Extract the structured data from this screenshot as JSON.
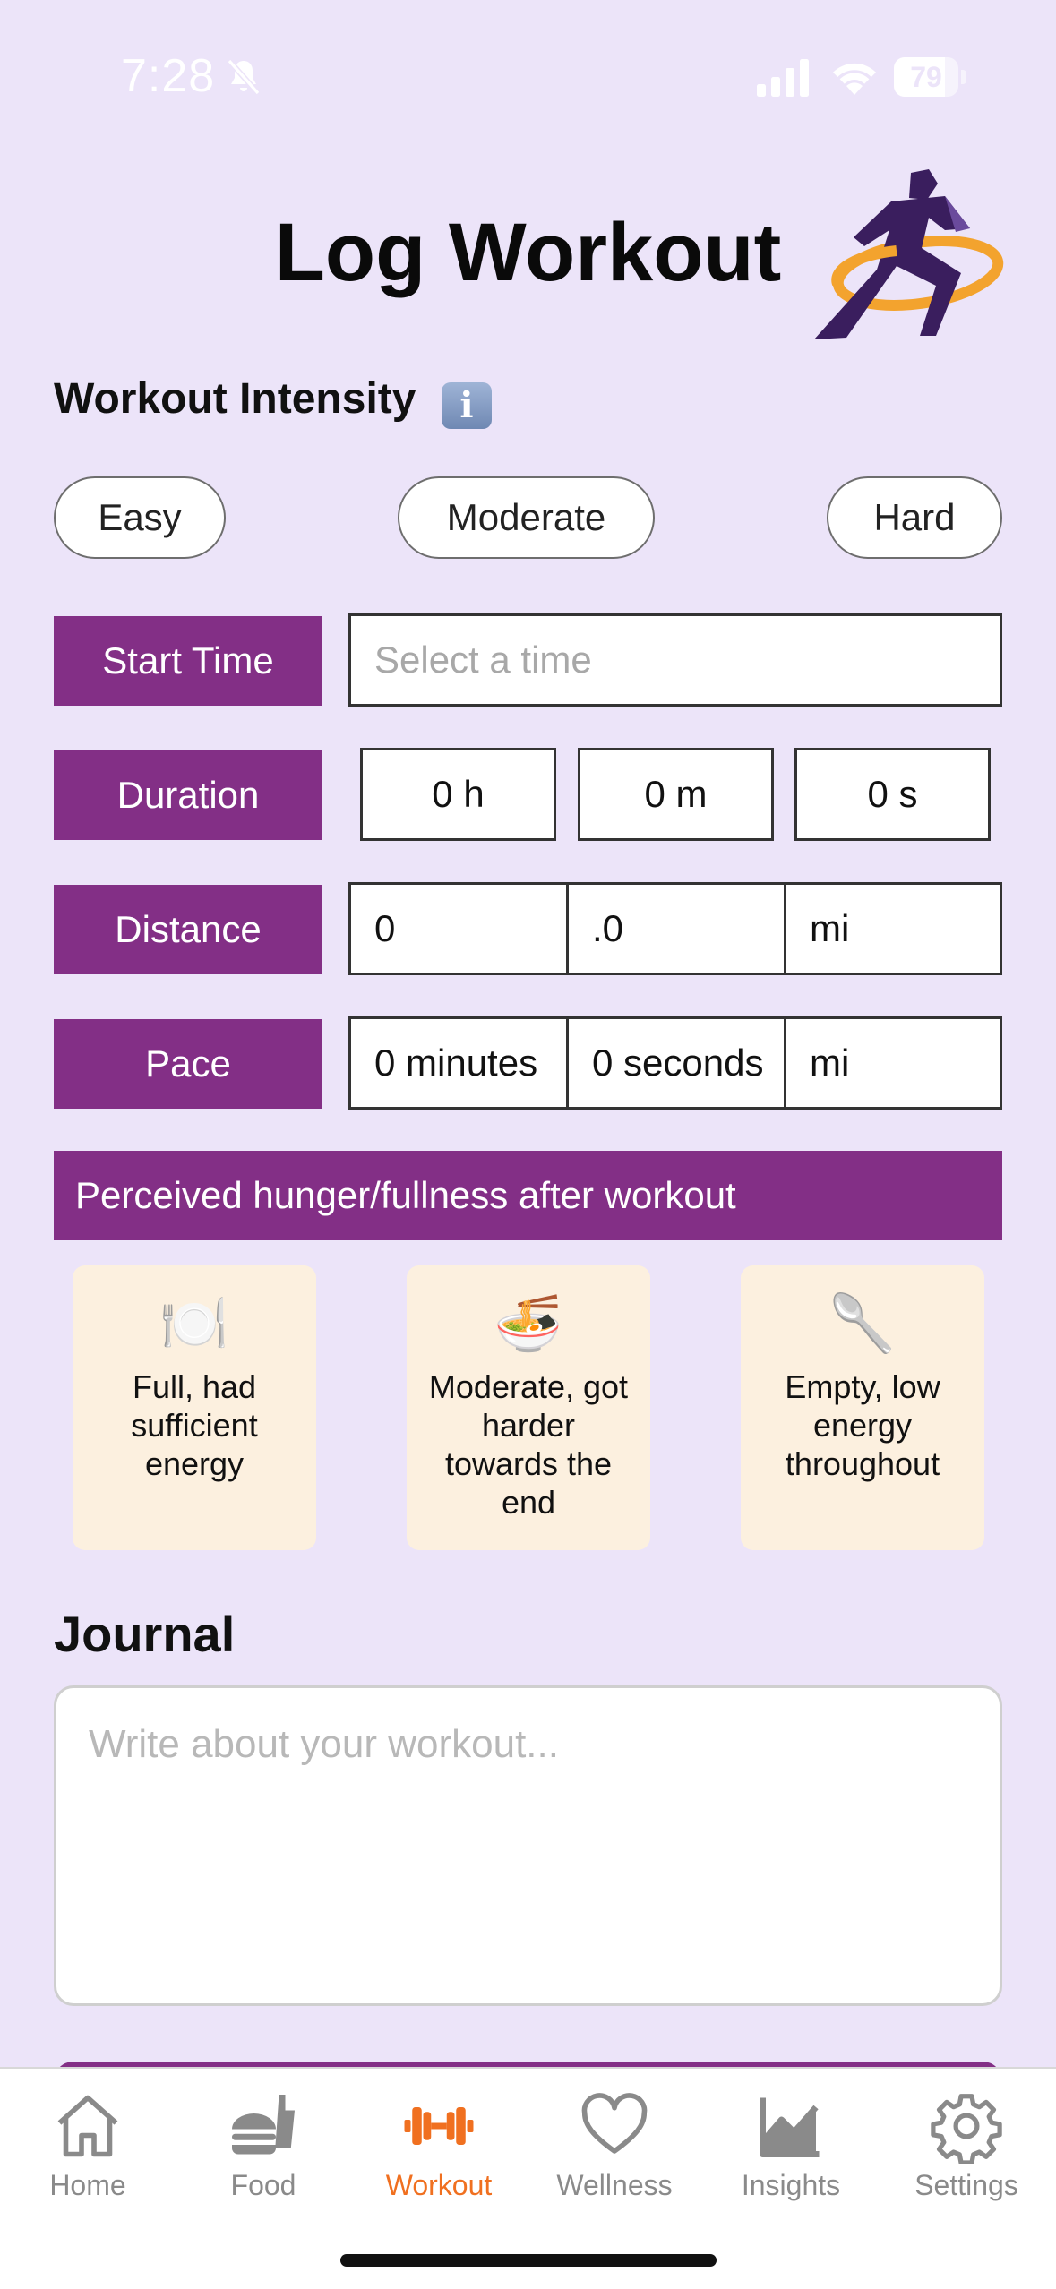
{
  "status_bar": {
    "time": "7:28",
    "battery": "79",
    "battery_level": 0.79
  },
  "header": {
    "title": "Log Workout"
  },
  "intensity": {
    "heading": "Workout Intensity",
    "info_icon": "i",
    "options": [
      "Easy",
      "Moderate",
      "Hard"
    ]
  },
  "start_time": {
    "label": "Start Time",
    "placeholder": "Select a time"
  },
  "duration": {
    "label": "Duration",
    "hours": "0 h",
    "minutes": "0 m",
    "seconds": "0 s"
  },
  "distance": {
    "label": "Distance",
    "whole": "0",
    "decimal": ".0",
    "unit": "mi"
  },
  "pace": {
    "label": "Pace",
    "minutes": "0 minutes",
    "seconds": "0 seconds",
    "unit": "mi"
  },
  "hunger": {
    "heading": "Perceived hunger/fullness after workout",
    "options": [
      {
        "icon": "🍽️",
        "icon_name": "plate-icon",
        "text": "Full, had sufficient energy"
      },
      {
        "icon": "🍜",
        "icon_name": "noodle-bowl-icon",
        "text": "Moderate, got harder towards the end"
      },
      {
        "icon": "🥄",
        "icon_name": "spoon-icon",
        "text": "Empty, low energy throughout"
      }
    ]
  },
  "journal": {
    "heading": "Journal",
    "placeholder": "Write about your workout..."
  },
  "tabs": [
    {
      "label": "Home",
      "icon": "home-icon"
    },
    {
      "label": "Food",
      "icon": "food-icon"
    },
    {
      "label": "Workout",
      "icon": "dumbbell-icon",
      "active": true
    },
    {
      "label": "Wellness",
      "icon": "heart-icon"
    },
    {
      "label": "Insights",
      "icon": "chart-icon"
    },
    {
      "label": "Settings",
      "icon": "gear-icon"
    }
  ],
  "colors": {
    "background": "#ece4f9",
    "label_purple": "#832f86",
    "active_tab": "#f07020",
    "card_bg": "#fcf0df"
  }
}
